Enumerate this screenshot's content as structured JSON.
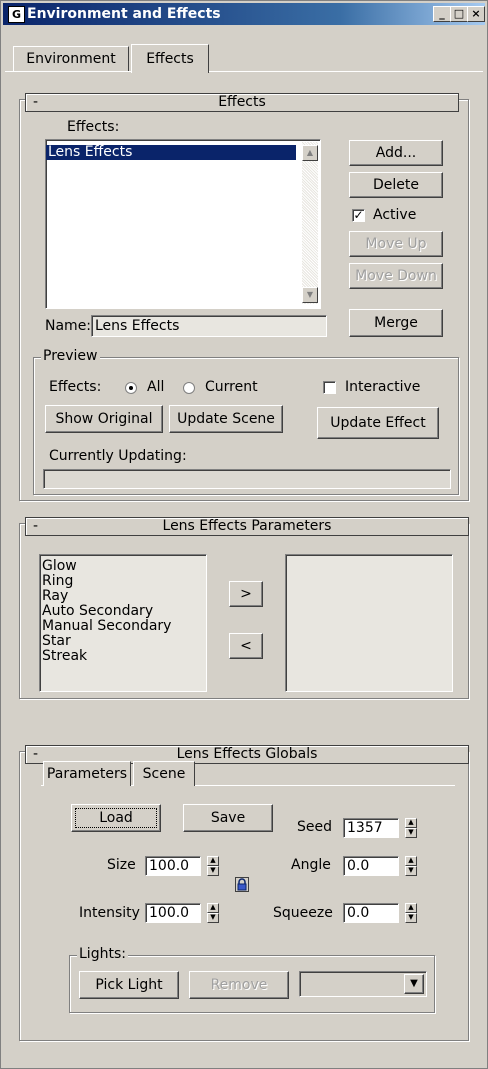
{
  "window": {
    "title": "Environment and Effects",
    "icon": "3ds-max-icon",
    "buttons": {
      "min": "_",
      "max": "□",
      "close": "×"
    }
  },
  "tabs": [
    {
      "label": "Environment"
    },
    {
      "label": "Effects"
    }
  ],
  "effects_rollout": {
    "title": "Effects",
    "collapse": "-",
    "list_label": "Effects:",
    "list_items": [
      "Lens Effects"
    ],
    "buttons": {
      "add": "Add...",
      "delete": "Delete",
      "move_up": "Move Up",
      "move_down": "Move Down",
      "merge": "Merge"
    },
    "active_label": "Active",
    "active_checked": true,
    "name_label": "Name:",
    "name_value": "Lens Effects",
    "preview": {
      "title": "Preview",
      "effects_label": "Effects:",
      "all_label": "All",
      "current_label": "Current",
      "interactive_label": "Interactive",
      "show_original": "Show Original",
      "update_scene": "Update Scene",
      "update_effect": "Update Effect",
      "currently_updating": "Currently Updating:"
    }
  },
  "lens_params_rollout": {
    "title": "Lens Effects Parameters",
    "collapse": "-",
    "available": [
      "Glow",
      "Ring",
      "Ray",
      "Auto Secondary",
      "Manual Secondary",
      "Star",
      "Streak"
    ],
    "add_arrow": ">",
    "remove_arrow": "<"
  },
  "lens_globals_rollout": {
    "title": "Lens Effects Globals",
    "collapse": "-",
    "tabs": [
      "Parameters",
      "Scene"
    ],
    "load": "Load",
    "save": "Save",
    "seed_label": "Seed",
    "seed_value": "1357",
    "size_label": "Size",
    "size_value": "100.0",
    "angle_label": "Angle",
    "angle_value": "0.0",
    "intensity_label": "Intensity",
    "intensity_value": "100.0",
    "squeeze_label": "Squeeze",
    "squeeze_value": "0.0",
    "lights": {
      "title": "Lights:",
      "pick_light": "Pick Light",
      "remove": "Remove",
      "dropdown_value": ""
    }
  }
}
